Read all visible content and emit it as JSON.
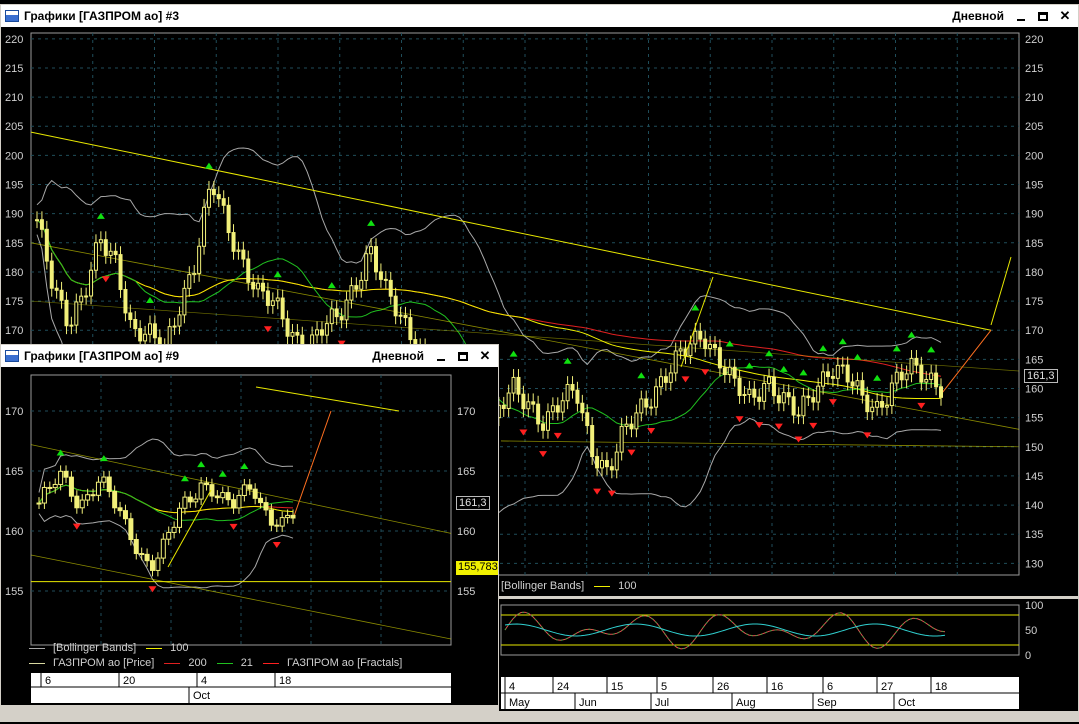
{
  "main_window": {
    "title": "Графики [ГАЗПРОМ ао] #3",
    "period": "Дневной",
    "y_ticks": [
      "220",
      "215",
      "210",
      "205",
      "200",
      "195",
      "190",
      "185",
      "180",
      "175",
      "170",
      "165",
      "160",
      "155",
      "150",
      "145",
      "140",
      "135",
      "130"
    ],
    "last_price": "161,3",
    "legend": {
      "bb": "[Bollinger Bands]",
      "ma100": "100"
    },
    "osc_ticks": [
      "100",
      "50",
      "0"
    ],
    "time_days": [
      "4",
      "24",
      "15",
      "5",
      "26",
      "16",
      "6",
      "27",
      "18"
    ],
    "time_months": [
      "May",
      "Jun",
      "Jul",
      "Aug",
      "Sep",
      "Oct"
    ]
  },
  "sub_window": {
    "title": "Графики [ГАЗПРОМ ао] #9",
    "period": "Дневной",
    "y_ticks": [
      "170",
      "165",
      "160",
      "155"
    ],
    "last_price": "161,3",
    "cursor_price": "155,783",
    "legend_row1": {
      "bb": "[Bollinger Bands]",
      "ma100": "100"
    },
    "legend_row2": {
      "price": "ГАЗПРОМ ао [Price]",
      "ma200": "200",
      "ma21": "21",
      "fractals": "ГАЗПРОМ ао [Fractals]"
    },
    "time_days": [
      "6",
      "20",
      "4",
      "18"
    ],
    "time_months": [
      "Oct"
    ]
  },
  "colors": {
    "candle": "#f2f07a",
    "ma200": "#e02020",
    "ma21": "#20c020",
    "ma100": "#f0f000",
    "bb": "#a8a8a8",
    "fractal_up": "#10e010",
    "fractal_down": "#ff2020",
    "trend": "#e8e800",
    "projection": "#ff7020",
    "grid": "#1f4d5a"
  },
  "chart_data": [
    {
      "type": "candlestick",
      "instrument": "ГАЗПРОМ ао",
      "ylim": [
        128,
        221
      ],
      "x_months": [
        "May",
        "Jun",
        "Jul",
        "Aug",
        "Sep",
        "Oct"
      ],
      "close_series_sampled": [
        188,
        178,
        172,
        176,
        185,
        182,
        170,
        169,
        166,
        175,
        182,
        195,
        188,
        182,
        176,
        174,
        170,
        167,
        170,
        172,
        178,
        184,
        176,
        172,
        168,
        162,
        158,
        150,
        145,
        155,
        160,
        158,
        154,
        157,
        160,
        150,
        145,
        152,
        157,
        160,
        163,
        167,
        170,
        165,
        160,
        158,
        162,
        158,
        155,
        160,
        164,
        162,
        158,
        157,
        161,
        163,
        162,
        161
      ],
      "last": 161.3
    },
    {
      "type": "candlestick",
      "instrument": "ГАЗПРОМ ао",
      "ylim": [
        150.5,
        173
      ],
      "x_months": [
        "Oct"
      ],
      "close_series_sampled": [
        162,
        163.5,
        165,
        164,
        162,
        163,
        164,
        163,
        161.5,
        160,
        158,
        157,
        158,
        160,
        162,
        163,
        164,
        163.5,
        162.5,
        162,
        163,
        164,
        162,
        161,
        160.5,
        161.3
      ],
      "last": 161.3,
      "cursor_price": 155.783
    }
  ]
}
